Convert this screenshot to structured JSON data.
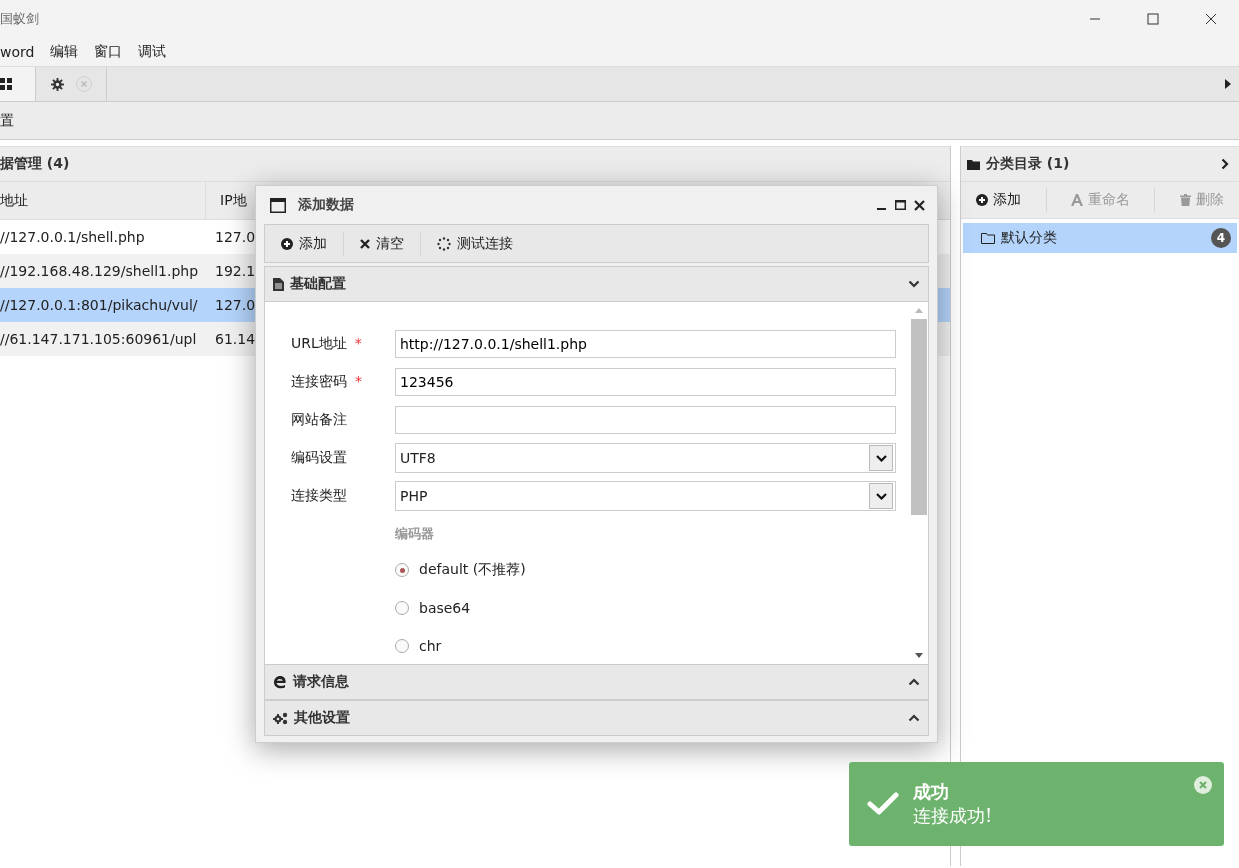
{
  "window": {
    "title": "国蚁剑"
  },
  "menu": [
    "word",
    "编辑",
    "窗口",
    "调试"
  ],
  "tabs": [
    {
      "kind": "grid",
      "selected": true
    },
    {
      "kind": "settings",
      "selected": false
    }
  ],
  "toolbar": {
    "label": "置"
  },
  "data_panel": {
    "title": "据管理 (4)",
    "columns": [
      "地址",
      "IP地"
    ],
    "rows": [
      {
        "url": "//127.0.0.1/shell.php",
        "ip": "127.0",
        "selected": false
      },
      {
        "url": "//192.168.48.129/shell1.php",
        "ip": "192.1",
        "selected": false
      },
      {
        "url": "//127.0.0.1:801/pikachu/vul/",
        "ip": "127.0",
        "selected": true
      },
      {
        "url": "//61.147.171.105:60961/upl",
        "ip": "61.14",
        "selected": false
      }
    ]
  },
  "category_panel": {
    "title": "分类目录 (1)",
    "actions": [
      {
        "label": "添加",
        "disabled": false
      },
      {
        "label": "重命名",
        "disabled": true
      },
      {
        "label": "删除",
        "disabled": true
      }
    ],
    "items": [
      {
        "label": "默认分类",
        "count": "4",
        "selected": true
      }
    ]
  },
  "dialog": {
    "title": "添加数据",
    "actions": [
      {
        "label": "添加"
      },
      {
        "label": "清空"
      },
      {
        "label": "测试连接"
      }
    ],
    "sections": [
      {
        "title": "基础配置",
        "expanded": true
      },
      {
        "title": "请求信息",
        "expanded": false
      },
      {
        "title": "其他设置",
        "expanded": false
      }
    ],
    "fields": [
      {
        "kind": "text",
        "label": "URL地址",
        "required_mark": "*",
        "value": "http://127.0.0.1/shell1.php"
      },
      {
        "kind": "text",
        "label": "连接密码",
        "required_mark": "*",
        "value": "123456"
      },
      {
        "kind": "text",
        "label": "网站备注"
      },
      {
        "kind": "select",
        "label": "编码设置",
        "value": "UTF8"
      },
      {
        "kind": "select",
        "label": "连接类型",
        "value": "PHP"
      }
    ],
    "encoder": {
      "label": "编码器",
      "options": [
        {
          "label": "default (不推荐)",
          "selected": true
        },
        {
          "label": "base64",
          "selected": false
        },
        {
          "label": "chr",
          "selected": false
        }
      ]
    }
  },
  "toast": {
    "title": "成功",
    "message": "连接成功!"
  }
}
